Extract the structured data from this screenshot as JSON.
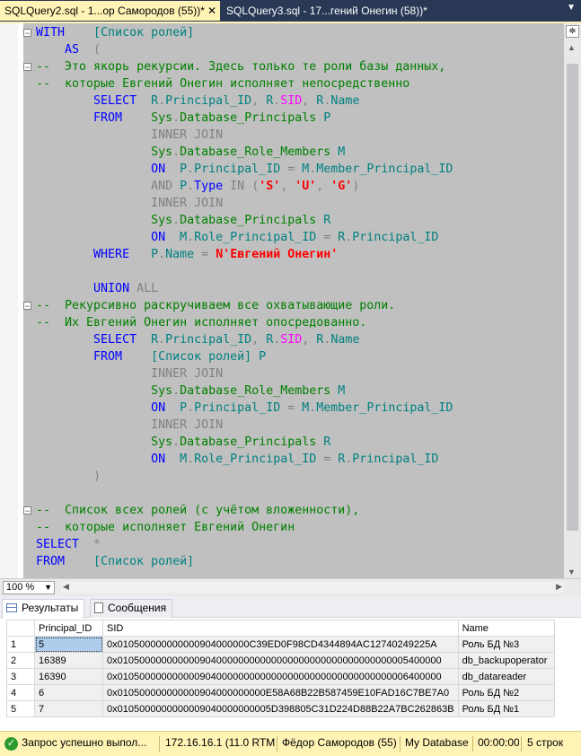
{
  "tabs": [
    {
      "label": "SQLQuery2.sql - 1...ор Самородов (55))*",
      "close": "✕"
    },
    {
      "label": "SQLQuery3.sql - 17...гений Онегин (58))*"
    }
  ],
  "tab_dropdown": "▼",
  "editor": {
    "lines": [
      [
        {
          "t": "WITH    ",
          "c": "kw"
        },
        {
          "t": "[Список ролей]",
          "c": "tl"
        }
      ],
      [
        {
          "t": "    AS  ",
          "c": "kw"
        },
        {
          "t": "(",
          "c": "gr"
        }
      ],
      [
        {
          "t": "--  Это якорь рекурсии. Здесь только те роли базы данных,",
          "c": "cm"
        }
      ],
      [
        {
          "t": "--  которые Евгений Онегин исполняет непосредственно",
          "c": "cm"
        }
      ],
      [
        {
          "t": "        SELECT  ",
          "c": "kw"
        },
        {
          "t": "R",
          "c": "tl"
        },
        {
          "t": ".",
          "c": "gr"
        },
        {
          "t": "Principal_ID",
          "c": "tl"
        },
        {
          "t": ", ",
          "c": "gr"
        },
        {
          "t": "R",
          "c": "tl"
        },
        {
          "t": ".",
          "c": "gr"
        },
        {
          "t": "SID",
          "c": "pk"
        },
        {
          "t": ", ",
          "c": "gr"
        },
        {
          "t": "R",
          "c": "tl"
        },
        {
          "t": ".",
          "c": "gr"
        },
        {
          "t": "Name",
          "c": "tl"
        }
      ],
      [
        {
          "t": "        FROM    ",
          "c": "kw"
        },
        {
          "t": "Sys",
          "c": "cm"
        },
        {
          "t": ".",
          "c": "gr"
        },
        {
          "t": "Database_Principals",
          "c": "cm"
        },
        {
          "t": " P",
          "c": "tl"
        }
      ],
      [
        {
          "t": "                INNER JOIN",
          "c": "gr"
        }
      ],
      [
        {
          "t": "                ",
          "c": "bk"
        },
        {
          "t": "Sys",
          "c": "cm"
        },
        {
          "t": ".",
          "c": "gr"
        },
        {
          "t": "Database_Role_Members",
          "c": "cm"
        },
        {
          "t": " M",
          "c": "tl"
        }
      ],
      [
        {
          "t": "                ON  ",
          "c": "kw"
        },
        {
          "t": "P",
          "c": "tl"
        },
        {
          "t": ".",
          "c": "gr"
        },
        {
          "t": "Principal_ID",
          "c": "tl"
        },
        {
          "t": " = ",
          "c": "gr"
        },
        {
          "t": "M",
          "c": "tl"
        },
        {
          "t": ".",
          "c": "gr"
        },
        {
          "t": "Member_Principal_ID",
          "c": "tl"
        }
      ],
      [
        {
          "t": "                AND ",
          "c": "gr"
        },
        {
          "t": "P",
          "c": "tl"
        },
        {
          "t": ".",
          "c": "gr"
        },
        {
          "t": "Type",
          "c": "kw"
        },
        {
          "t": " IN (",
          "c": "gr"
        },
        {
          "t": "'S'",
          "c": "rd"
        },
        {
          "t": ", ",
          "c": "gr"
        },
        {
          "t": "'U'",
          "c": "rd"
        },
        {
          "t": ", ",
          "c": "gr"
        },
        {
          "t": "'G'",
          "c": "rd"
        },
        {
          "t": ")",
          "c": "gr"
        }
      ],
      [
        {
          "t": "                INNER JOIN",
          "c": "gr"
        }
      ],
      [
        {
          "t": "                ",
          "c": "bk"
        },
        {
          "t": "Sys",
          "c": "cm"
        },
        {
          "t": ".",
          "c": "gr"
        },
        {
          "t": "Database_Principals",
          "c": "cm"
        },
        {
          "t": " R",
          "c": "tl"
        }
      ],
      [
        {
          "t": "                ON  ",
          "c": "kw"
        },
        {
          "t": "M",
          "c": "tl"
        },
        {
          "t": ".",
          "c": "gr"
        },
        {
          "t": "Role_Principal_ID",
          "c": "tl"
        },
        {
          "t": " = ",
          "c": "gr"
        },
        {
          "t": "R",
          "c": "tl"
        },
        {
          "t": ".",
          "c": "gr"
        },
        {
          "t": "Principal_ID",
          "c": "tl"
        }
      ],
      [
        {
          "t": "        WHERE   ",
          "c": "kw"
        },
        {
          "t": "P",
          "c": "tl"
        },
        {
          "t": ".",
          "c": "gr"
        },
        {
          "t": "Name",
          "c": "tl"
        },
        {
          "t": " = ",
          "c": "gr"
        },
        {
          "t": "N'Евгений Онегин'",
          "c": "rd"
        }
      ],
      [],
      [
        {
          "t": "        UNION ",
          "c": "kw"
        },
        {
          "t": "ALL",
          "c": "gr"
        }
      ],
      [
        {
          "t": "--  Рекурсивно раскручиваем все охватывающие роли.",
          "c": "cm"
        }
      ],
      [
        {
          "t": "--  Их Евгений Онегин исполняет опосредованно.",
          "c": "cm"
        }
      ],
      [
        {
          "t": "        SELECT  ",
          "c": "kw"
        },
        {
          "t": "R",
          "c": "tl"
        },
        {
          "t": ".",
          "c": "gr"
        },
        {
          "t": "Principal_ID",
          "c": "tl"
        },
        {
          "t": ", ",
          "c": "gr"
        },
        {
          "t": "R",
          "c": "tl"
        },
        {
          "t": ".",
          "c": "gr"
        },
        {
          "t": "SID",
          "c": "pk"
        },
        {
          "t": ", ",
          "c": "gr"
        },
        {
          "t": "R",
          "c": "tl"
        },
        {
          "t": ".",
          "c": "gr"
        },
        {
          "t": "Name",
          "c": "tl"
        }
      ],
      [
        {
          "t": "        FROM    ",
          "c": "kw"
        },
        {
          "t": "[Список ролей]",
          "c": "tl"
        },
        {
          "t": " P",
          "c": "tl"
        }
      ],
      [
        {
          "t": "                INNER JOIN",
          "c": "gr"
        }
      ],
      [
        {
          "t": "                ",
          "c": "bk"
        },
        {
          "t": "Sys",
          "c": "cm"
        },
        {
          "t": ".",
          "c": "gr"
        },
        {
          "t": "Database_Role_Members",
          "c": "cm"
        },
        {
          "t": " M",
          "c": "tl"
        }
      ],
      [
        {
          "t": "                ON  ",
          "c": "kw"
        },
        {
          "t": "P",
          "c": "tl"
        },
        {
          "t": ".",
          "c": "gr"
        },
        {
          "t": "Principal_ID",
          "c": "tl"
        },
        {
          "t": " = ",
          "c": "gr"
        },
        {
          "t": "M",
          "c": "tl"
        },
        {
          "t": ".",
          "c": "gr"
        },
        {
          "t": "Member_Principal_ID",
          "c": "tl"
        }
      ],
      [
        {
          "t": "                INNER JOIN",
          "c": "gr"
        }
      ],
      [
        {
          "t": "                ",
          "c": "bk"
        },
        {
          "t": "Sys",
          "c": "cm"
        },
        {
          "t": ".",
          "c": "gr"
        },
        {
          "t": "Database_Principals",
          "c": "cm"
        },
        {
          "t": " R",
          "c": "tl"
        }
      ],
      [
        {
          "t": "                ON  ",
          "c": "kw"
        },
        {
          "t": "M",
          "c": "tl"
        },
        {
          "t": ".",
          "c": "gr"
        },
        {
          "t": "Role_Principal_ID",
          "c": "tl"
        },
        {
          "t": " = ",
          "c": "gr"
        },
        {
          "t": "R",
          "c": "tl"
        },
        {
          "t": ".",
          "c": "gr"
        },
        {
          "t": "Principal_ID",
          "c": "tl"
        }
      ],
      [
        {
          "t": "        )",
          "c": "gr"
        }
      ],
      [],
      [
        {
          "t": "--  Список всех ролей (с учётом вложенности),",
          "c": "cm"
        }
      ],
      [
        {
          "t": "--  которые исполняет Евгений Онегин",
          "c": "cm"
        }
      ],
      [
        {
          "t": "SELECT  ",
          "c": "kw"
        },
        {
          "t": "*",
          "c": "gr"
        }
      ],
      [
        {
          "t": "FROM    ",
          "c": "kw"
        },
        {
          "t": "[Список ролей]",
          "c": "tl"
        }
      ]
    ],
    "fold_markers": [
      "−",
      "−",
      "−",
      "−",
      "−",
      "−"
    ]
  },
  "zoom": {
    "value": "100 %",
    "arrow": "▼"
  },
  "results": {
    "tabs": [
      {
        "label": "Результаты",
        "icon": "grid-icon"
      },
      {
        "label": "Сообщения",
        "icon": "message-icon"
      }
    ],
    "columns": [
      "",
      "Principal_ID",
      "SID",
      "Name"
    ],
    "rows": [
      [
        "1",
        "5",
        "0x010500000000000904000000C39ED0F98CD4344894AC12740249225A",
        "Роль БД №3"
      ],
      [
        "2",
        "16389",
        "0x01050000000000090400000000000000000000000000000000005400000",
        "db_backupoperator"
      ],
      [
        "3",
        "16390",
        "0x01050000000000090400000000000000000000000000000000006400000",
        "db_datareader"
      ],
      [
        "4",
        "6",
        "0x010500000000000904000000000E58A68B22B587459E10FAD16C7BE7A0",
        "Роль БД №2"
      ],
      [
        "5",
        "7",
        "0x0105000000000009040000000005D398805C31D224D88B22A7BC262863B",
        "Роль БД №1"
      ]
    ]
  },
  "status": {
    "message": "Запрос успешно выпол...",
    "server": "172.16.16.1 (11.0 RTM)",
    "user": "Фёдор Самородов (55)",
    "database": "My Database",
    "time": "00:00:00",
    "rows": "5 строк"
  },
  "colors": {
    "tab_active": "#fff3b5",
    "chrome": "#293955",
    "selection": "#c0c0c0",
    "keyword": "#0000ff",
    "comment": "#008000",
    "string": "#ff0000"
  }
}
